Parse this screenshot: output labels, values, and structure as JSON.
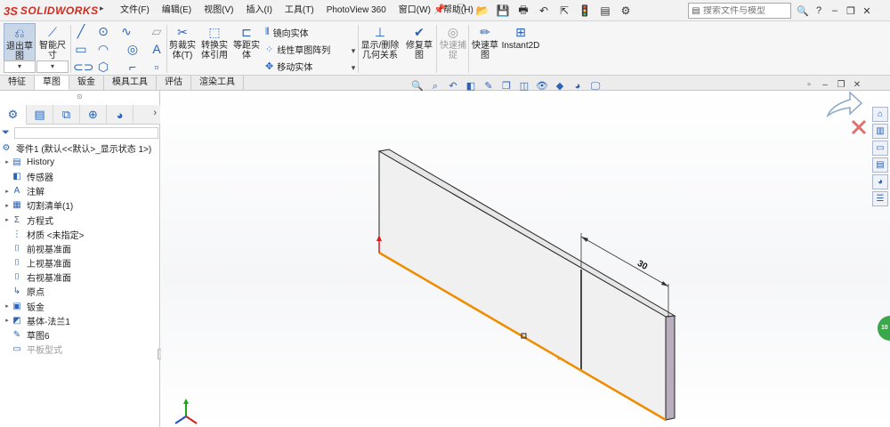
{
  "app": {
    "logo_mark": "3S",
    "logo_text": "SOLIDWORKS",
    "menu": [
      "文件(F)",
      "编辑(E)",
      "视图(V)",
      "插入(I)",
      "工具(T)",
      "PhotoView 360",
      "窗口(W)",
      "帮助(H)"
    ],
    "search_placeholder": "搜索文件与模型"
  },
  "ribbon": {
    "exit_sketch": "退出草\n图",
    "smart_dimension": "智能尺\n寸",
    "trim": "剪裁实\n体(T)",
    "convert": "转换实\n体引用",
    "offset": "等距实\n体",
    "mirror": "镜向实体",
    "linear_pattern": "线性草图阵列",
    "move": "移动实体",
    "display_relations": "显示/删除\n几何关系",
    "repair": "修复草\n图",
    "quick_snap": "快速捕\n捉",
    "rapid_sketch": "快速草\n图",
    "instant2d": "Instant2D"
  },
  "tabs": [
    {
      "label": "特征",
      "active": false
    },
    {
      "label": "草图",
      "active": true
    },
    {
      "label": "钣金",
      "active": false
    },
    {
      "label": "模具工具",
      "active": false
    },
    {
      "label": "评估",
      "active": false
    },
    {
      "label": "渲染工具",
      "active": false
    }
  ],
  "tree": [
    {
      "label": "零件1 (默认<<默认>_显示状态 1>)",
      "icon": "part-icon",
      "glyph": "⚙",
      "expand": "",
      "root": true,
      "grey": false
    },
    {
      "label": "History",
      "icon": "history-icon",
      "glyph": "▤",
      "expand": "▸",
      "grey": false
    },
    {
      "label": "传感器",
      "icon": "sensor-icon",
      "glyph": "◧",
      "expand": "",
      "grey": false
    },
    {
      "label": "注解",
      "icon": "annotation-icon",
      "glyph": "A",
      "expand": "▸",
      "grey": false
    },
    {
      "label": "切割清单(1)",
      "icon": "cut-list-icon",
      "glyph": "▦",
      "expand": "▸",
      "grey": false
    },
    {
      "label": "方程式",
      "icon": "equation-icon",
      "glyph": "Σ",
      "expand": "▸",
      "grey": false
    },
    {
      "label": "材质 <未指定>",
      "icon": "material-icon",
      "glyph": "⋮",
      "expand": "",
      "grey": false
    },
    {
      "label": "前视基准面",
      "icon": "plane-icon",
      "glyph": "⌷",
      "expand": "",
      "grey": false
    },
    {
      "label": "上视基准面",
      "icon": "plane-icon",
      "glyph": "⌷",
      "expand": "",
      "grey": false
    },
    {
      "label": "右视基准面",
      "icon": "plane-icon",
      "glyph": "⌷",
      "expand": "",
      "grey": false
    },
    {
      "label": "原点",
      "icon": "origin-icon",
      "glyph": "↳",
      "expand": "",
      "grey": false
    },
    {
      "label": "钣金",
      "icon": "sheet-metal-icon",
      "glyph": "▣",
      "expand": "▸",
      "grey": false
    },
    {
      "label": "基体-法兰1",
      "icon": "base-flange-icon",
      "glyph": "◩",
      "expand": "▸",
      "grey": false
    },
    {
      "label": "草图6",
      "icon": "sketch-icon",
      "glyph": "✎",
      "expand": "",
      "grey": false
    },
    {
      "label": "平板型式",
      "icon": "flat-pattern-icon",
      "glyph": "▭",
      "expand": "",
      "grey": true
    }
  ],
  "viewport": {
    "dimension_value": "30",
    "sketch_color": "#f08c00",
    "part_face_color": "#f0f0f0",
    "part_edge_color": "#202020",
    "part_side_color": "#b8aebe",
    "triad_colors": {
      "x": "#d42020",
      "y": "#18a818",
      "z": "#2050d0"
    }
  },
  "task_pane_badge": "10"
}
